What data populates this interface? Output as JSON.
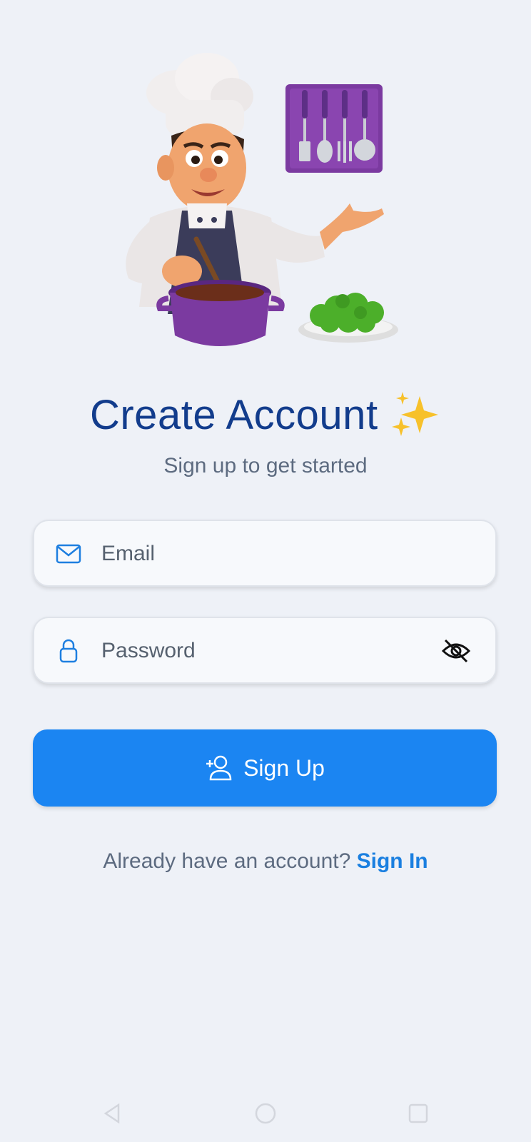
{
  "header": {
    "title": "Create Account",
    "subtitle": "Sign up to get started"
  },
  "form": {
    "email": {
      "placeholder": "Email",
      "value": "",
      "icon": "mail-icon"
    },
    "password": {
      "placeholder": "Password",
      "value": "",
      "icon": "lock-icon",
      "toggle_icon": "eye-off-icon"
    },
    "signup_label": "Sign Up",
    "signup_icon": "user-plus-icon"
  },
  "footer": {
    "prompt": "Already have an account?",
    "link": "Sign In"
  },
  "navbar": {
    "back_icon": "back-triangle-icon",
    "home_icon": "home-circle-icon",
    "recents_icon": "recents-square-icon"
  },
  "colors": {
    "background": "#eef1f7",
    "title": "#123c8c",
    "primary": "#1b85f2",
    "link": "#1a7fe0",
    "muted": "#5d6b80"
  }
}
